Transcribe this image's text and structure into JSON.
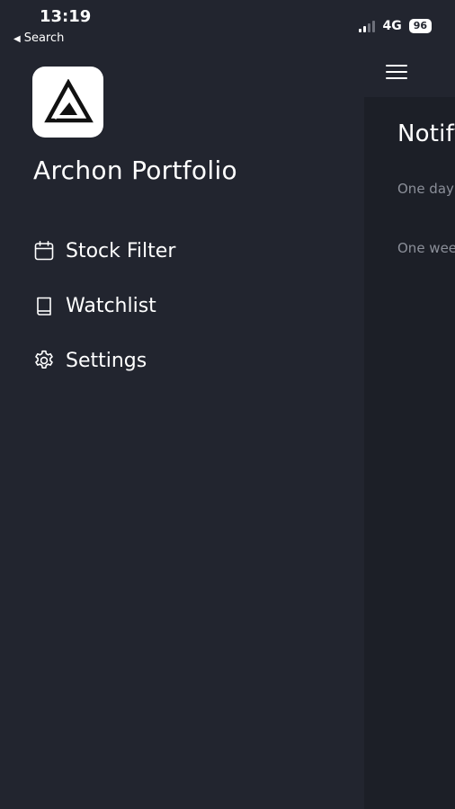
{
  "status_bar": {
    "time": "13:19",
    "back_label": "Search",
    "network": "4G",
    "battery": "96"
  },
  "drawer": {
    "app_title": "Archon Portfolio",
    "logo_icon": "archon-triangle-logo",
    "menu": [
      {
        "label": "Stock Filter",
        "icon": "calendar-icon"
      },
      {
        "label": "Watchlist",
        "icon": "book-icon"
      },
      {
        "label": "Settings",
        "icon": "gear-icon"
      }
    ]
  },
  "background_page": {
    "title": "Notify",
    "notes": [
      "One day",
      "One week"
    ]
  },
  "colors": {
    "drawer_bg": "#22252f",
    "content_bg": "#1c1f27",
    "text": "#ffffff",
    "muted_text": "#8b8f99"
  }
}
